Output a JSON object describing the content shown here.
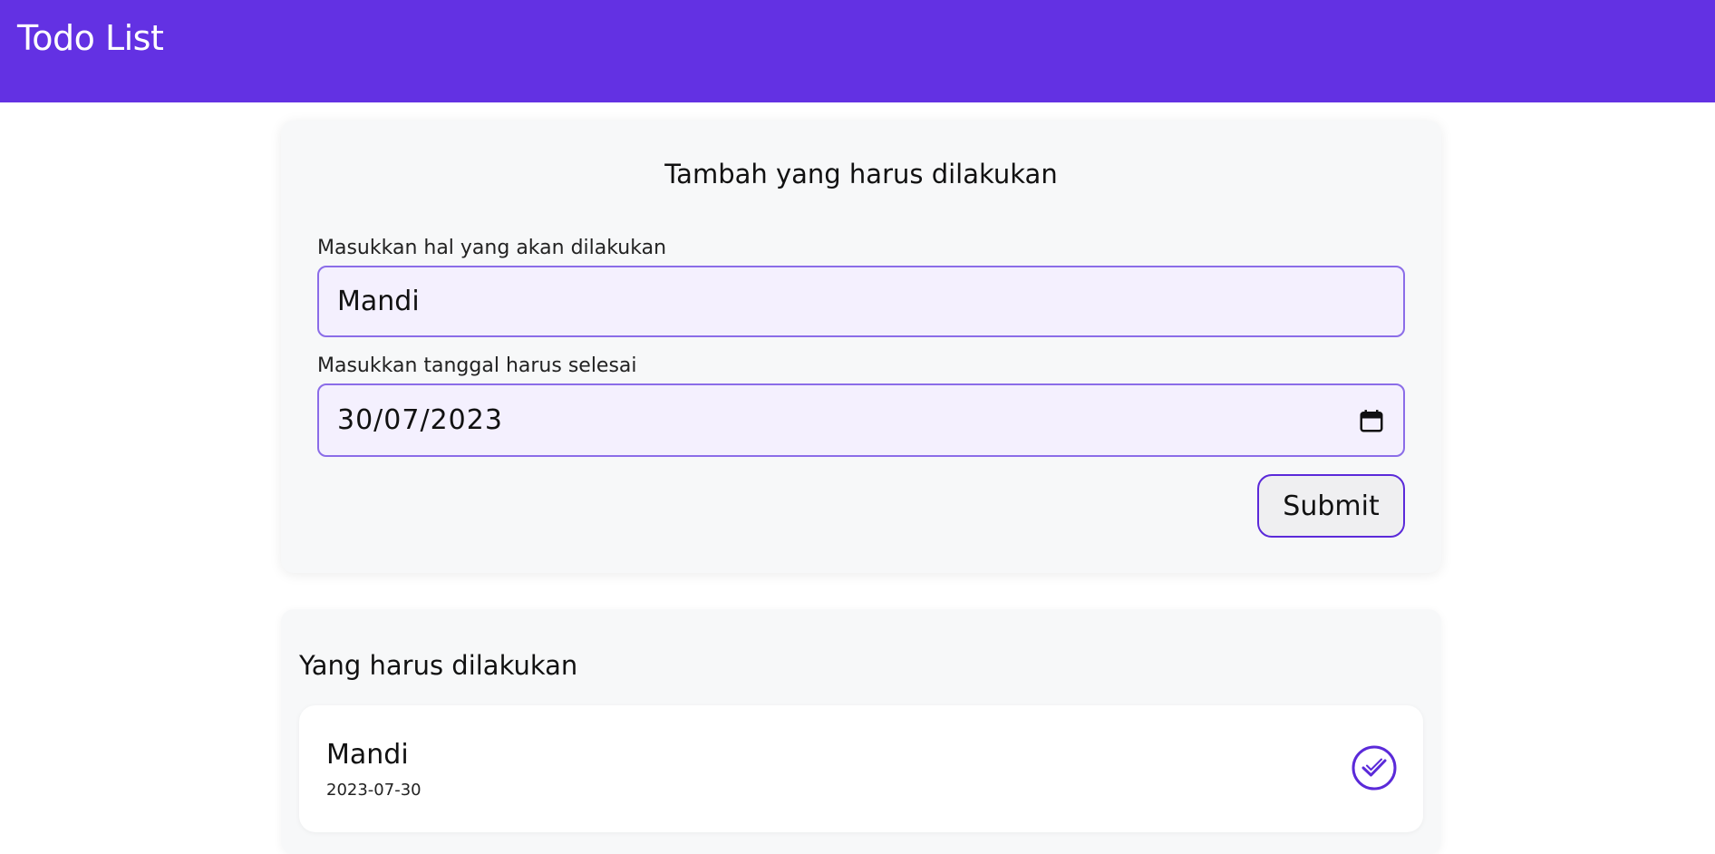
{
  "header": {
    "title": "Todo List"
  },
  "form": {
    "title": "Tambah yang harus dilakukan",
    "title_label": "Masukkan hal yang akan dilakukan",
    "title_value": "Mandi",
    "date_label": "Masukkan tanggal harus selesai",
    "date_value": "30/07/2023",
    "date_icon": "calendar-icon",
    "submit_label": "Submit"
  },
  "todo_list": {
    "title": "Yang harus dilakukan",
    "items": [
      {
        "name": "Mandi",
        "date": "2023-07-30",
        "action_icon": "check-circle-icon"
      }
    ]
  },
  "colors": {
    "header_bg": "#6331e3",
    "accent": "#5b2ad9",
    "input_bg": "#f4f0fe",
    "input_border": "#8b6de8",
    "card_bg": "#f7f8f9"
  }
}
